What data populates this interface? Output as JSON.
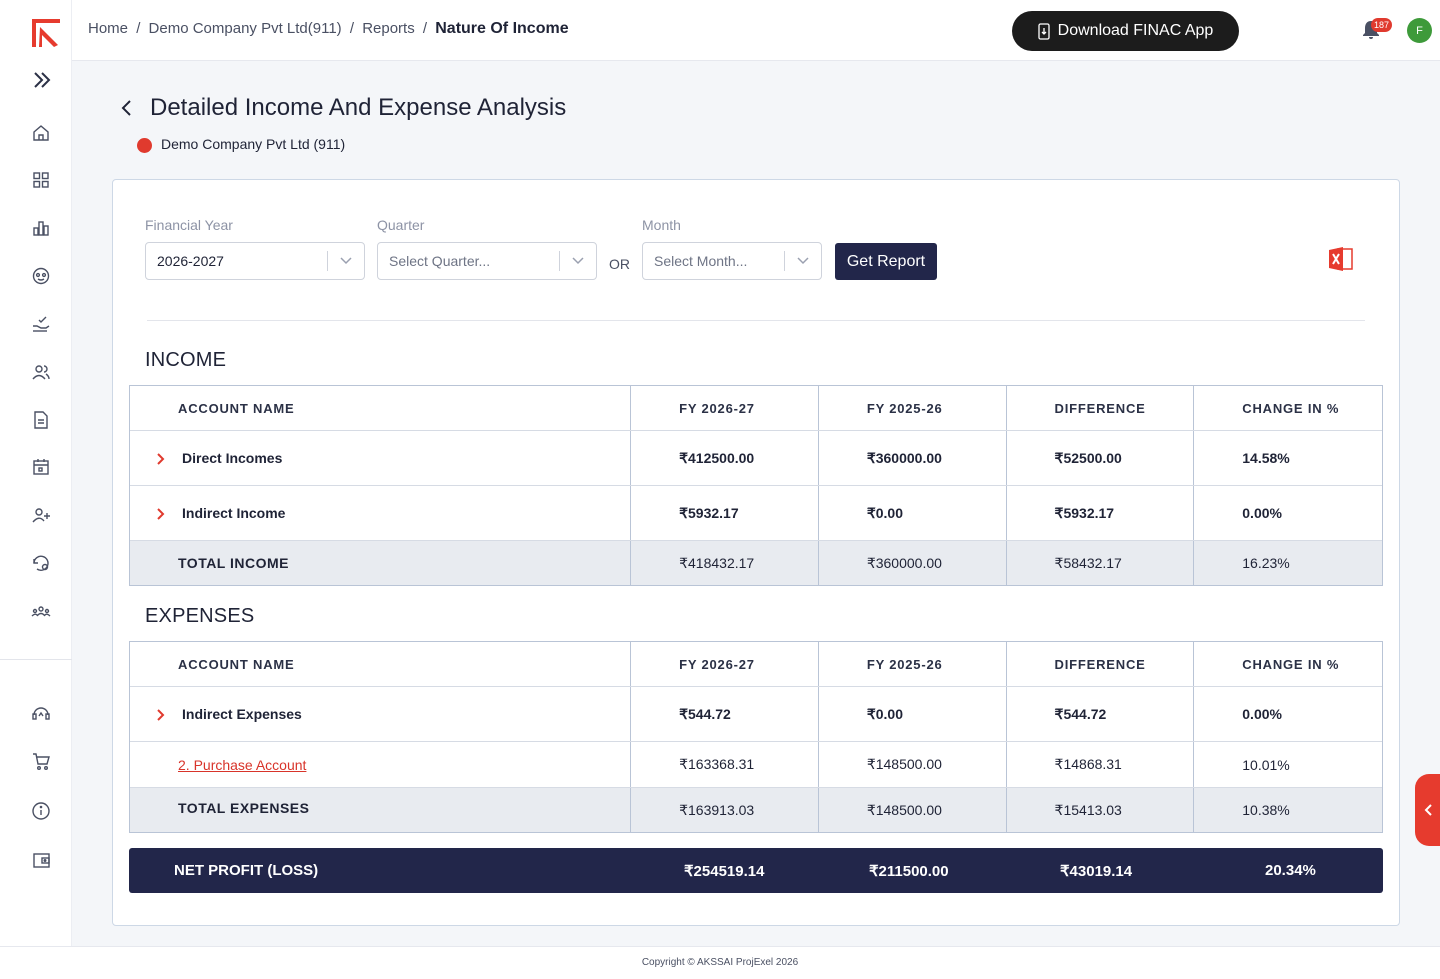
{
  "header": {
    "breadcrumb": [
      "Home",
      "Demo Company Pvt Ltd(911)",
      "Reports"
    ],
    "breadcrumb_current": "Nature Of Income",
    "download_label": "Download FINAC App",
    "notification_count": "187",
    "avatar_initial": "F"
  },
  "page": {
    "title": "Detailed Income And Expense Analysis",
    "company": "Demo Company Pvt Ltd (911)"
  },
  "filters": {
    "financial_year_label": "Financial Year",
    "financial_year_value": "2026-2027",
    "quarter_label": "Quarter",
    "quarter_placeholder": "Select Quarter...",
    "or_label": "OR",
    "month_label": "Month",
    "month_placeholder": "Select Month...",
    "get_report_label": "Get Report"
  },
  "columns": [
    "ACCOUNT NAME",
    "FY 2026-27",
    "FY 2025-26",
    "DIFFERENCE",
    "CHANGE IN %"
  ],
  "income": {
    "title": "INCOME",
    "rows": [
      {
        "name": "Direct Incomes",
        "fy1": "₹412500.00",
        "fy2": "₹360000.00",
        "diff": "₹52500.00",
        "pct": "14.58%"
      },
      {
        "name": "Indirect Income",
        "fy1": "₹5932.17",
        "fy2": "₹0.00",
        "diff": "₹5932.17",
        "pct": "0.00%"
      }
    ],
    "total": {
      "name": "TOTAL INCOME",
      "fy1": "₹418432.17",
      "fy2": "₹360000.00",
      "diff": "₹58432.17",
      "pct": "16.23%"
    }
  },
  "expenses": {
    "title": "EXPENSES",
    "rows": [
      {
        "name": "Indirect Expenses",
        "fy1": "₹544.72",
        "fy2": "₹0.00",
        "diff": "₹544.72",
        "pct": "0.00%"
      },
      {
        "name": "2. Purchase Account",
        "fy1": "₹163368.31",
        "fy2": "₹148500.00",
        "diff": "₹14868.31",
        "pct": "10.01%"
      }
    ],
    "total": {
      "name": "TOTAL EXPENSES",
      "fy1": "₹163913.03",
      "fy2": "₹148500.00",
      "diff": "₹15413.03",
      "pct": "10.38%"
    }
  },
  "net_profit": {
    "name": "NET PROFIT (LOSS)",
    "fy1": "₹254519.14",
    "fy2": "₹211500.00",
    "diff": "₹43019.14",
    "pct": "20.34%"
  },
  "footer": {
    "copyright": "Copyright © AKSSAI ProjExel 2026"
  },
  "colors": {
    "accent": "#e63b2e",
    "navy": "#22264a",
    "link": "#d8342a"
  },
  "icons": {
    "sidebar": [
      "home-icon",
      "dashboard-grid-icon",
      "chart-bar-icon",
      "palette-icon",
      "hand-check-icon",
      "users-icon",
      "document-icon",
      "calendar-icon",
      "user-add-icon",
      "history-settings-icon",
      "team-icon",
      "support-icon",
      "cart-icon",
      "info-icon",
      "wallet-icon"
    ]
  }
}
